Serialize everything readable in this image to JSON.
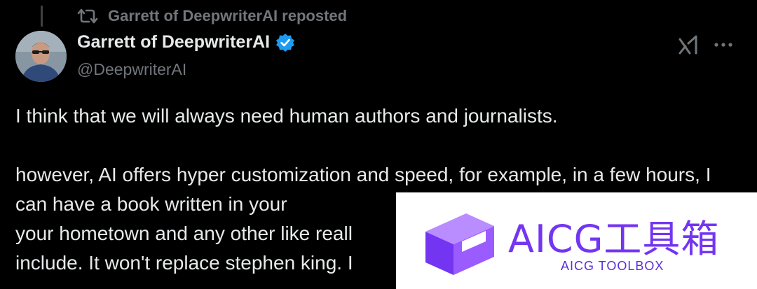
{
  "repost": {
    "label": "Garrett of DeepwriterAI reposted",
    "icon": "repost-icon"
  },
  "author": {
    "display_name": "Garrett of DeepwriterAI",
    "handle": "@DeepwriterAI",
    "verified": true,
    "verified_color": "#1d9bf0"
  },
  "actions": {
    "grok_icon": "grok-icon",
    "more_icon": "more-options-icon"
  },
  "tweet": {
    "text": "I think that we will always need human authors and journalists.\n\nhowever, AI offers hyper customization and speed, for example, in a few hours, I can have a book written in your\nyour hometown and any other like reall\ninclude. It won't replace stephen king. I"
  },
  "watermark": {
    "title": "AICG工具箱",
    "subtitle": "AICG TOOLBOX",
    "color": "#7335f2"
  },
  "colors": {
    "background": "#000000",
    "text": "#e7e9ea",
    "secondary": "#71767b"
  }
}
